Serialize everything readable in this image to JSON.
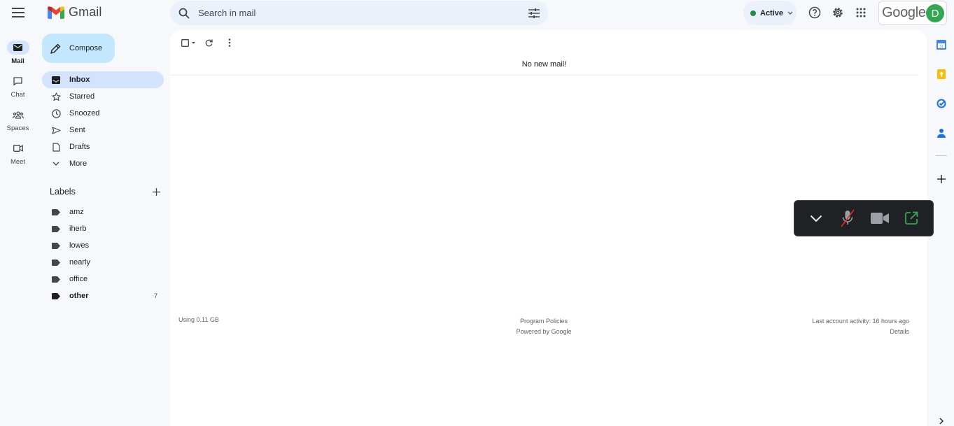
{
  "app": {
    "name": "Gmail",
    "accent": "#0b57d0",
    "brand_colors": [
      "#ea4335",
      "#4285f4",
      "#34a853",
      "#fbbc04"
    ]
  },
  "header": {
    "search_placeholder": "Search in mail",
    "status_label": "Active",
    "status_color": "#1e8e3e",
    "google_word": "Google",
    "avatar_initial": "D",
    "icons": [
      "menu-icon",
      "search-icon",
      "tune-icon",
      "help-icon",
      "settings-icon",
      "apps-icon"
    ]
  },
  "rail": {
    "items": [
      {
        "label": "Mail",
        "icon": "mail-icon",
        "active": true
      },
      {
        "label": "Chat",
        "icon": "chat-icon",
        "active": false
      },
      {
        "label": "Spaces",
        "icon": "spaces-icon",
        "active": false
      },
      {
        "label": "Meet",
        "icon": "meet-icon",
        "active": false
      }
    ]
  },
  "sidebar": {
    "compose_label": "Compose",
    "nav": [
      {
        "label": "Inbox",
        "icon": "inbox-icon",
        "active": true
      },
      {
        "label": "Starred",
        "icon": "star-icon"
      },
      {
        "label": "Snoozed",
        "icon": "clock-icon"
      },
      {
        "label": "Sent",
        "icon": "send-icon"
      },
      {
        "label": "Drafts",
        "icon": "draft-icon"
      },
      {
        "label": "More",
        "icon": "chevron-down-icon"
      }
    ],
    "labels_title": "Labels",
    "labels": [
      {
        "name": "amz",
        "count": ""
      },
      {
        "name": "iherb",
        "count": ""
      },
      {
        "name": "lowes",
        "count": ""
      },
      {
        "name": "nearly",
        "count": ""
      },
      {
        "name": "office",
        "count": ""
      },
      {
        "name": "other",
        "count": "7"
      }
    ]
  },
  "main": {
    "empty_message": "No new mail!",
    "footer": {
      "storage": "Using 0.11 GB",
      "policies": "Program Policies",
      "powered": "Powered by Google",
      "last_activity": "Last account activity: 16 hours ago",
      "details": "Details"
    }
  },
  "call_controls": {
    "icons": [
      "collapse-icon",
      "mic-off-icon",
      "camera-icon",
      "popout-icon"
    ]
  },
  "right_rail": {
    "icons": [
      "calendar-icon",
      "keep-icon",
      "tasks-icon",
      "contacts-icon",
      "add-icon",
      "expand-icon"
    ]
  }
}
